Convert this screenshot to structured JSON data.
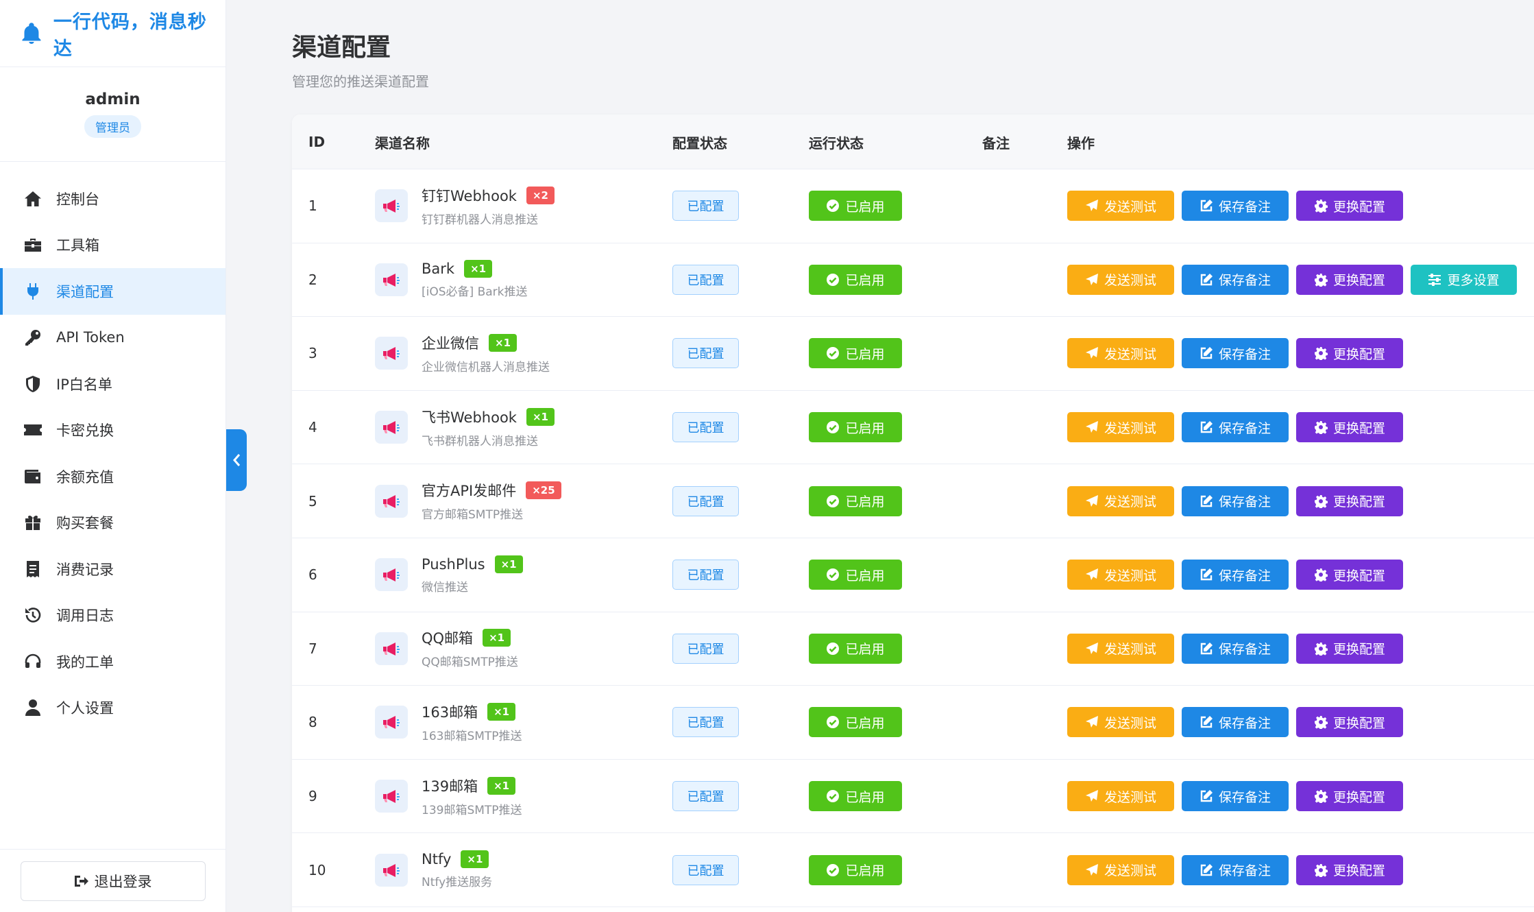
{
  "brand": {
    "title": "一行代码，消息秒达",
    "icon": "bell-icon"
  },
  "user": {
    "name": "admin",
    "role": "管理员"
  },
  "menu": [
    {
      "label": "控制台",
      "icon": "home-icon"
    },
    {
      "label": "工具箱",
      "icon": "toolbox-icon"
    },
    {
      "label": "渠道配置",
      "icon": "plug-icon",
      "active": true
    },
    {
      "label": "API Token",
      "icon": "key-icon"
    },
    {
      "label": "IP白名单",
      "icon": "shield-icon"
    },
    {
      "label": "卡密兑换",
      "icon": "ticket-icon"
    },
    {
      "label": "余额充值",
      "icon": "wallet-icon"
    },
    {
      "label": "购买套餐",
      "icon": "gift-icon"
    },
    {
      "label": "消费记录",
      "icon": "receipt-icon"
    },
    {
      "label": "调用日志",
      "icon": "history-icon"
    },
    {
      "label": "我的工单",
      "icon": "headset-icon"
    },
    {
      "label": "个人设置",
      "icon": "user-icon"
    }
  ],
  "logout_label": "退出登录",
  "page": {
    "title": "渠道配置",
    "subtitle": "管理您的推送渠道配置"
  },
  "table": {
    "headers": {
      "id": "ID",
      "name": "渠道名称",
      "config": "配置状态",
      "run": "运行状态",
      "note": "备注",
      "ops": "操作"
    },
    "config_label": "已配置",
    "run_label": "已启用",
    "buttons": {
      "test": "发送测试",
      "save": "保存备注",
      "change": "更换配置",
      "more": "更多设置"
    },
    "colors": {
      "test": "#faad14",
      "save": "#1e88e5",
      "change": "#7531d8",
      "more": "#1ec2c2",
      "badge_red": "#f25a5a",
      "badge_green": "#52c41a"
    },
    "rows": [
      {
        "id": "1",
        "name": "钉钉Webhook",
        "badge": "×2",
        "badge_color": "red",
        "desc": "钉钉群机器人消息推送",
        "more": false
      },
      {
        "id": "2",
        "name": "Bark",
        "badge": "×1",
        "badge_color": "green",
        "desc": "[iOS必备] Bark推送",
        "more": true
      },
      {
        "id": "3",
        "name": "企业微信",
        "badge": "×1",
        "badge_color": "green",
        "desc": "企业微信机器人消息推送",
        "more": false
      },
      {
        "id": "4",
        "name": "飞书Webhook",
        "badge": "×1",
        "badge_color": "green",
        "desc": "飞书群机器人消息推送",
        "more": false
      },
      {
        "id": "5",
        "name": "官方API发邮件",
        "badge": "×25",
        "badge_color": "red",
        "desc": "官方邮箱SMTP推送",
        "more": false
      },
      {
        "id": "6",
        "name": "PushPlus",
        "badge": "×1",
        "badge_color": "green",
        "desc": "微信推送",
        "more": false
      },
      {
        "id": "7",
        "name": "QQ邮箱",
        "badge": "×1",
        "badge_color": "green",
        "desc": "QQ邮箱SMTP推送",
        "more": false
      },
      {
        "id": "8",
        "name": "163邮箱",
        "badge": "×1",
        "badge_color": "green",
        "desc": "163邮箱SMTP推送",
        "more": false
      },
      {
        "id": "9",
        "name": "139邮箱",
        "badge": "×1",
        "badge_color": "green",
        "desc": "139邮箱SMTP推送",
        "more": false
      },
      {
        "id": "10",
        "name": "Ntfy",
        "badge": "×1",
        "badge_color": "green",
        "desc": "Ntfy推送服务",
        "more": false
      }
    ]
  }
}
